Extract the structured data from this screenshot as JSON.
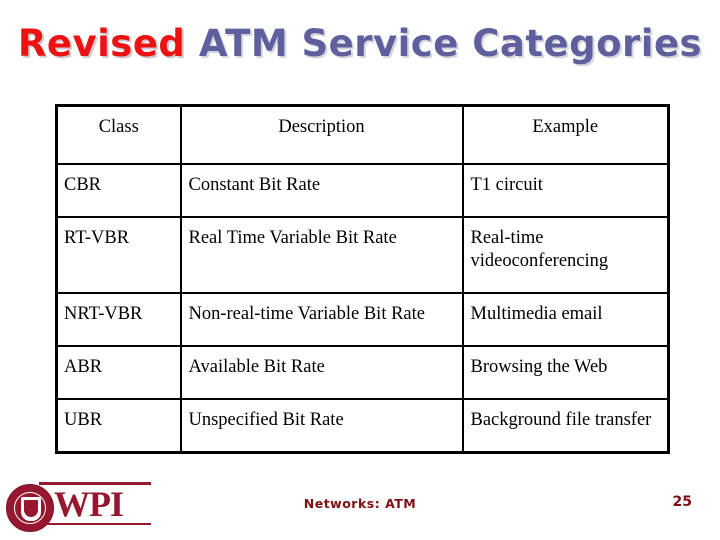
{
  "slide": {
    "title_part_red": "Revised",
    "title_part_blue": "ATM Service Categories",
    "title_red_color": "#EE1111",
    "title_blue_color": "#5F5F9E"
  },
  "table": {
    "headers": [
      "Class",
      "Description",
      "Example"
    ],
    "rows": [
      {
        "class": "CBR",
        "description": "Constant Bit Rate",
        "example": "T1 circuit"
      },
      {
        "class": "RT-VBR",
        "description": "Real Time Variable Bit Rate",
        "example": "Real-time videoconferencing"
      },
      {
        "class": "NRT-VBR",
        "description": "Non-real-time Variable Bit Rate",
        "example": "Multimedia email"
      },
      {
        "class": "ABR",
        "description": "Available Bit Rate",
        "example": "Browsing the Web"
      },
      {
        "class": "UBR",
        "description": "Unspecified Bit Rate",
        "example": "Background file transfer"
      }
    ]
  },
  "footer": {
    "logo_text": "WPI",
    "logo_color": "#96172E",
    "center_text": "Networks: ATM",
    "page_number": "25",
    "accent_color": "#7E1013"
  }
}
